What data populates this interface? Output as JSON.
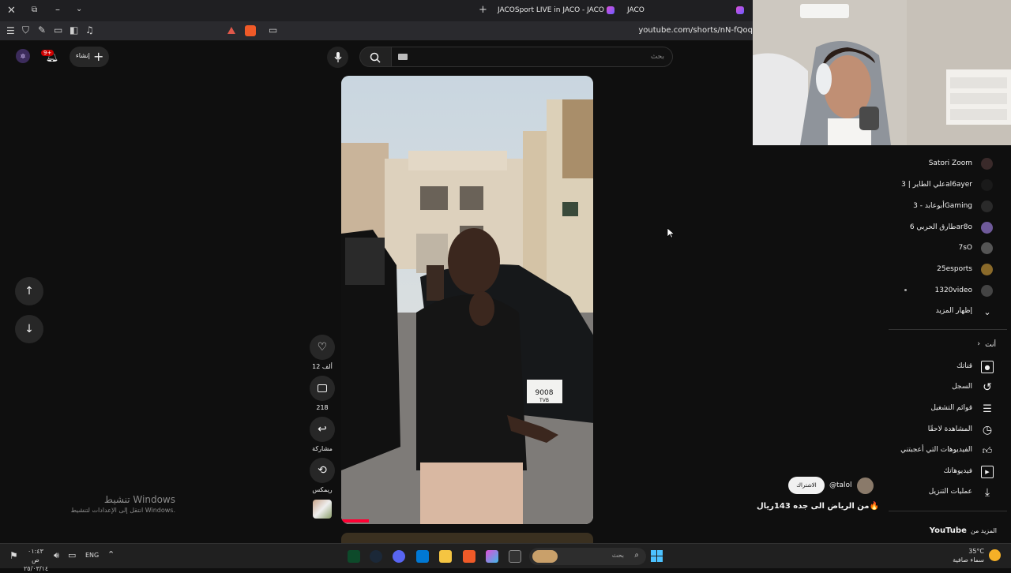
{
  "browser": {
    "tabs": [
      {
        "label": "JACOSport LIVE in JACO - JACO"
      },
      {
        "label": "JACO"
      }
    ],
    "new_tab": "+",
    "url": "youtube.com/shorts/nN-fQoq"
  },
  "header": {
    "create_label": "إنشاء",
    "notif_badge": "9+",
    "search_placeholder": "بحث"
  },
  "short": {
    "likes": "12 ألف",
    "comments": "218",
    "share_label": "مشاركة",
    "remix_label": "ريمكس",
    "channel_handle": "@talol",
    "subscribe_label": "الاشتراك",
    "title": "من الرياض الى جده 143ريال🔥",
    "plate_number": "9008",
    "plate_letters": "TVB"
  },
  "sidebar": {
    "subscriptions": [
      {
        "label": "Satori Zoom",
        "color": "#3a2a2a"
      },
      {
        "label": "علي الطاير | 3al6ayer",
        "color": "#1a1a1a"
      },
      {
        "label": "أبوعابد - 3Gaming",
        "color": "#2a2a2a"
      },
      {
        "label": "طارق الحربي 6ar8o",
        "color": "#6f5a9a"
      },
      {
        "label": "7sO",
        "color": "#555555"
      },
      {
        "label": "25esports",
        "color": "#8a6a2a"
      },
      {
        "label": "1320video",
        "color": "#444444"
      }
    ],
    "show_more": "إظهار المزيد",
    "you_header": "أنت",
    "you_items": [
      {
        "label": "قناتك",
        "icon": "person-icon"
      },
      {
        "label": "السجل",
        "icon": "history-icon"
      },
      {
        "label": "قوائم التشغيل",
        "icon": "playlists-icon"
      },
      {
        "label": "المشاهدة لاحقًا",
        "icon": "clock-icon"
      },
      {
        "label": "الفيديوهات التي أعجبتني",
        "icon": "thumbs-up-icon"
      },
      {
        "label": "فيديوهاتك",
        "icon": "play-icon"
      },
      {
        "label": "عمليات التنزيل",
        "icon": "download-icon"
      }
    ],
    "more_from": "المزيد من",
    "youtube_label": "YouTube"
  },
  "watermark": {
    "title": "تنشيط Windows",
    "subtitle": "انتقل إلى الإعدادات لتنشيط Windows."
  },
  "taskbar": {
    "time": "٠١:٤٣ ص",
    "date": "٢٥/٠٣/١٤",
    "lang": "ENG",
    "search_placeholder": "بحث",
    "weather_temp": "35°C",
    "weather_desc": "سماء صافية"
  }
}
